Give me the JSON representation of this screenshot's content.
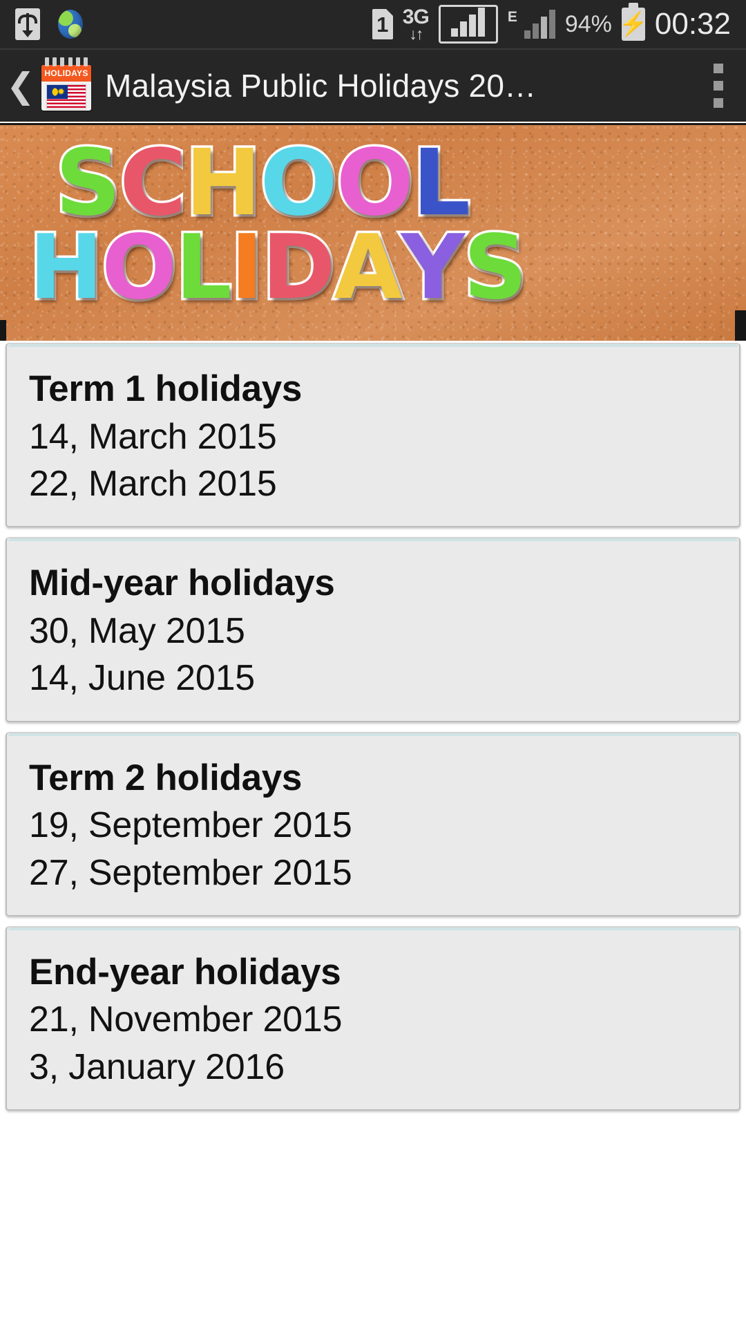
{
  "status_bar": {
    "usb_icon": "usb-icon",
    "globe_icon": "globe-icon",
    "sim_label": "1",
    "network_type": "3G",
    "network_arrows": "↓↑",
    "edge_label": "E",
    "battery_percent": "94%",
    "charging_glyph": "⚡",
    "clock": "00:32"
  },
  "title_bar": {
    "back_glyph": "❮",
    "app_icon_header": "HOLIDAYS",
    "app_icon_star": "✹",
    "title": "Malaysia Public Holidays 20…",
    "overflow_glyph": "overflow-menu-icon"
  },
  "banner": {
    "alt": "school-holidays-banner",
    "line1": [
      {
        "ch": "S",
        "color": "#6ddb3a"
      },
      {
        "ch": "C",
        "color": "#e8566a"
      },
      {
        "ch": "H",
        "color": "#f2c93f"
      },
      {
        "ch": "O",
        "color": "#58d7e8"
      },
      {
        "ch": "O",
        "color": "#e85fd0"
      },
      {
        "ch": "L",
        "color": "#3b53c9"
      }
    ],
    "line2": [
      {
        "ch": "H",
        "color": "#58d7e8"
      },
      {
        "ch": "O",
        "color": "#e85fd0"
      },
      {
        "ch": "L",
        "color": "#6ddb3a"
      },
      {
        "ch": "I",
        "color": "#f57c20"
      },
      {
        "ch": "D",
        "color": "#e8566a"
      },
      {
        "ch": "A",
        "color": "#f2c93f"
      },
      {
        "ch": "Y",
        "color": "#8a5fe0"
      },
      {
        "ch": "S",
        "color": "#6ddb3a"
      }
    ]
  },
  "cards": [
    {
      "title": "Term 1 holidays",
      "date1": "14, March 2015",
      "date2": "22, March 2015"
    },
    {
      "title": "Mid-year holidays",
      "date1": "30, May 2015",
      "date2": "14, June 2015"
    },
    {
      "title": "Term 2 holidays",
      "date1": "19, September 2015",
      "date2": "27, September 2015"
    },
    {
      "title": "End-year holidays",
      "date1": "21, November 2015",
      "date2": "3, January 2016"
    }
  ],
  "colors": {
    "status_bar_bg": "#262626",
    "title_bar_bg": "#262626",
    "card_bg": "#eaeaea",
    "card_border": "#bdbdbd",
    "card_accent": "#cfe3e3",
    "page_bg": "#ffffff",
    "cork_base": "#cf8047"
  }
}
